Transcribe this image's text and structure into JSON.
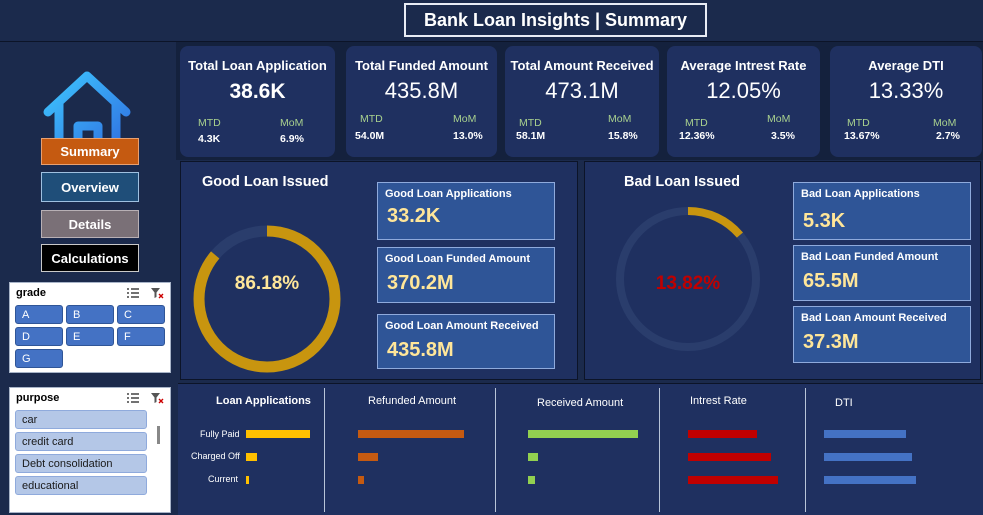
{
  "title": "Bank Loan Insights | Summary",
  "nav": {
    "summary": "Summary",
    "overview": "Overview",
    "details": "Details",
    "calculations": "Calculations"
  },
  "slicers": {
    "grade": {
      "title": "grade",
      "items": [
        "A",
        "B",
        "C",
        "D",
        "E",
        "F",
        "G"
      ]
    },
    "purpose": {
      "title": "purpose",
      "items": [
        "car",
        "credit card",
        "Debt consolidation",
        "educational"
      ]
    }
  },
  "kpis": [
    {
      "title": "Total Loan Application",
      "value": "38.6K",
      "mtd_label": "MTD",
      "mtd": "4.3K",
      "mom_label": "MoM",
      "mom": "6.9%"
    },
    {
      "title": "Total Funded Amount",
      "value": "435.8M",
      "mtd_label": "MTD",
      "mtd": "54.0M",
      "mom_label": "MoM",
      "mom": "13.0%"
    },
    {
      "title": "Total Amount Received",
      "value": "473.1M",
      "mtd_label": "MTD",
      "mtd": "58.1M",
      "mom_label": "MoM",
      "mom": "15.8%"
    },
    {
      "title": "Average Intrest Rate",
      "value": "12.05%",
      "mtd_label": "MTD",
      "mtd": "12.36%",
      "mom_label": "MoM",
      "mom": "3.5%"
    },
    {
      "title": "Average DTI",
      "value": "13.33%",
      "mtd_label": "MTD",
      "mtd": "13.67%",
      "mom_label": "MoM",
      "mom": "2.7%"
    }
  ],
  "good_loan": {
    "title": "Good Loan Issued",
    "percent_label": "86.18%",
    "percent": 86.18,
    "applications_label": "Good Loan Applications",
    "applications": "33.2K",
    "funded_label": "Good Loan Funded Amount",
    "funded": "370.2M",
    "received_label": "Good Loan Amount Received",
    "received": "435.8M"
  },
  "bad_loan": {
    "title": "Bad Loan Issued",
    "percent_label": "13.82%",
    "percent": 13.82,
    "applications_label": "Bad Loan Applications",
    "applications": "5.3K",
    "funded_label": "Bad Loan Funded Amount",
    "funded": "65.5M",
    "received_label": "Bad Loan Amount Received",
    "received": "37.3M"
  },
  "colors": {
    "good": "#c8950f",
    "bad": "#c00000",
    "applications": "#ffc000",
    "refunded": "#c55a11",
    "received": "#92d050",
    "interest": "#c00000",
    "dti": "#4472c4"
  },
  "chart_data": {
    "type": "bar",
    "categories": [
      "Fully Paid",
      "Charged Off",
      "Current"
    ],
    "series": [
      {
        "name": "Loan Applications",
        "values": [
          32145,
          5333,
          1098
        ]
      },
      {
        "name": "Refunded Amount",
        "values": [
          351358350,
          65532225,
          18866500
        ]
      },
      {
        "name": "Received Amount",
        "values": [
          411586256,
          37284763,
          24199914
        ]
      },
      {
        "name": "Intrest Rate",
        "values": [
          11.64,
          13.88,
          15.1
        ]
      },
      {
        "name": "DTI",
        "values": [
          13.17,
          14.0,
          14.72
        ]
      }
    ]
  }
}
